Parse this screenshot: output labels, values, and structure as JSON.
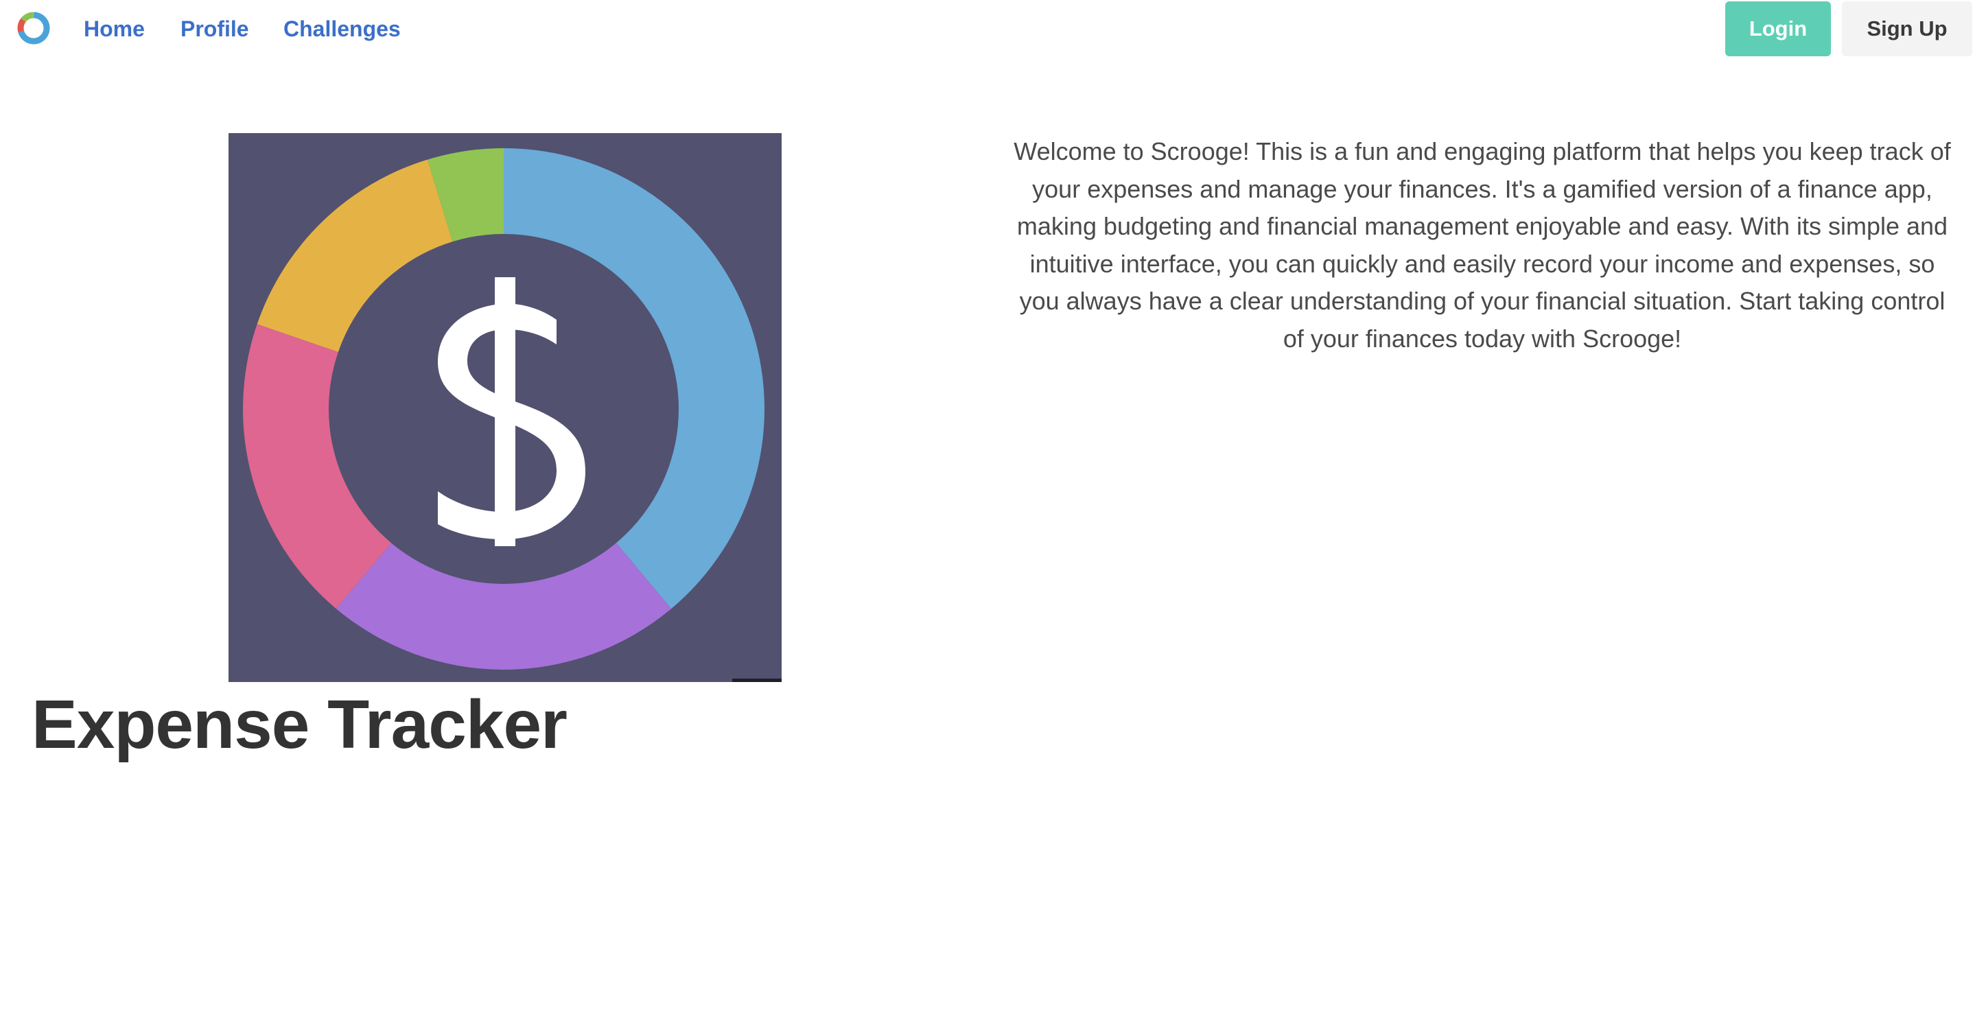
{
  "nav": {
    "logo_icon": "donut-chart-logo-icon",
    "links": [
      {
        "label": "Home"
      },
      {
        "label": "Profile"
      },
      {
        "label": "Challenges"
      }
    ],
    "login_label": "Login",
    "signup_label": "Sign Up"
  },
  "hero": {
    "image_icon": "dollar-donut-chart-icon",
    "title": "Expense Tracker",
    "welcome": "Welcome to Scrooge! This is a fun and engaging platform that helps you keep track of your expenses and manage your finances. It's a gamified version of a finance app, making budgeting and financial management enjoyable and easy. With its simple and intuitive interface, you can quickly and easily record your income and expenses, so you always have a clear understanding of your financial situation. Start taking control of your finances today with Scrooge!"
  },
  "colors": {
    "link": "#3b6fc9",
    "login_bg": "#5ecfb4",
    "signup_bg": "#f3f3f3",
    "image_bg": "#525170",
    "segment_blue": "#6aabd8",
    "segment_purple": "#a671d9",
    "segment_pink": "#de6690",
    "segment_yellow": "#e5b345",
    "segment_green": "#92c453"
  }
}
